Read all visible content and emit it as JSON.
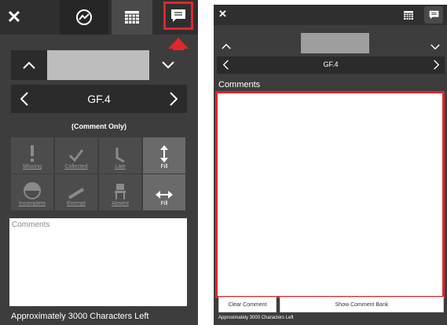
{
  "left": {
    "close_icon_glyph": "✕",
    "record_label": "GF.4",
    "mode_label": "(Comment Only)",
    "tiles": [
      {
        "label": "Missing",
        "icon": "exclamation-icon",
        "active": false
      },
      {
        "label": "Collected",
        "icon": "check-icon",
        "active": false
      },
      {
        "label": "Late",
        "icon": "late-icon",
        "active": false
      },
      {
        "label": "Fill",
        "icon": "vertical-arrows-icon",
        "active": true
      },
      {
        "label": "Incomplete",
        "icon": "half-circle-icon",
        "active": false
      },
      {
        "label": "Exempt",
        "icon": "slash-icon",
        "active": false
      },
      {
        "label": "Absent",
        "icon": "chair-icon",
        "active": false
      },
      {
        "label": "Fill",
        "icon": "horizontal-arrows-icon",
        "active": true
      }
    ],
    "comments_placeholder": "Comments",
    "chars_left": "Approximately 3000 Characters Left"
  },
  "right": {
    "close_icon_glyph": "✕",
    "record_label": "GF.4",
    "comments_heading": "Comments",
    "clear_button": "Clear Comment",
    "bank_button": "Show Comment Bank",
    "chars_left": "Approximately 3000 Characters Left"
  },
  "colors": {
    "highlight": "#e0262d",
    "panel": "#3d3d3d",
    "bar": "#2f2f2f"
  }
}
